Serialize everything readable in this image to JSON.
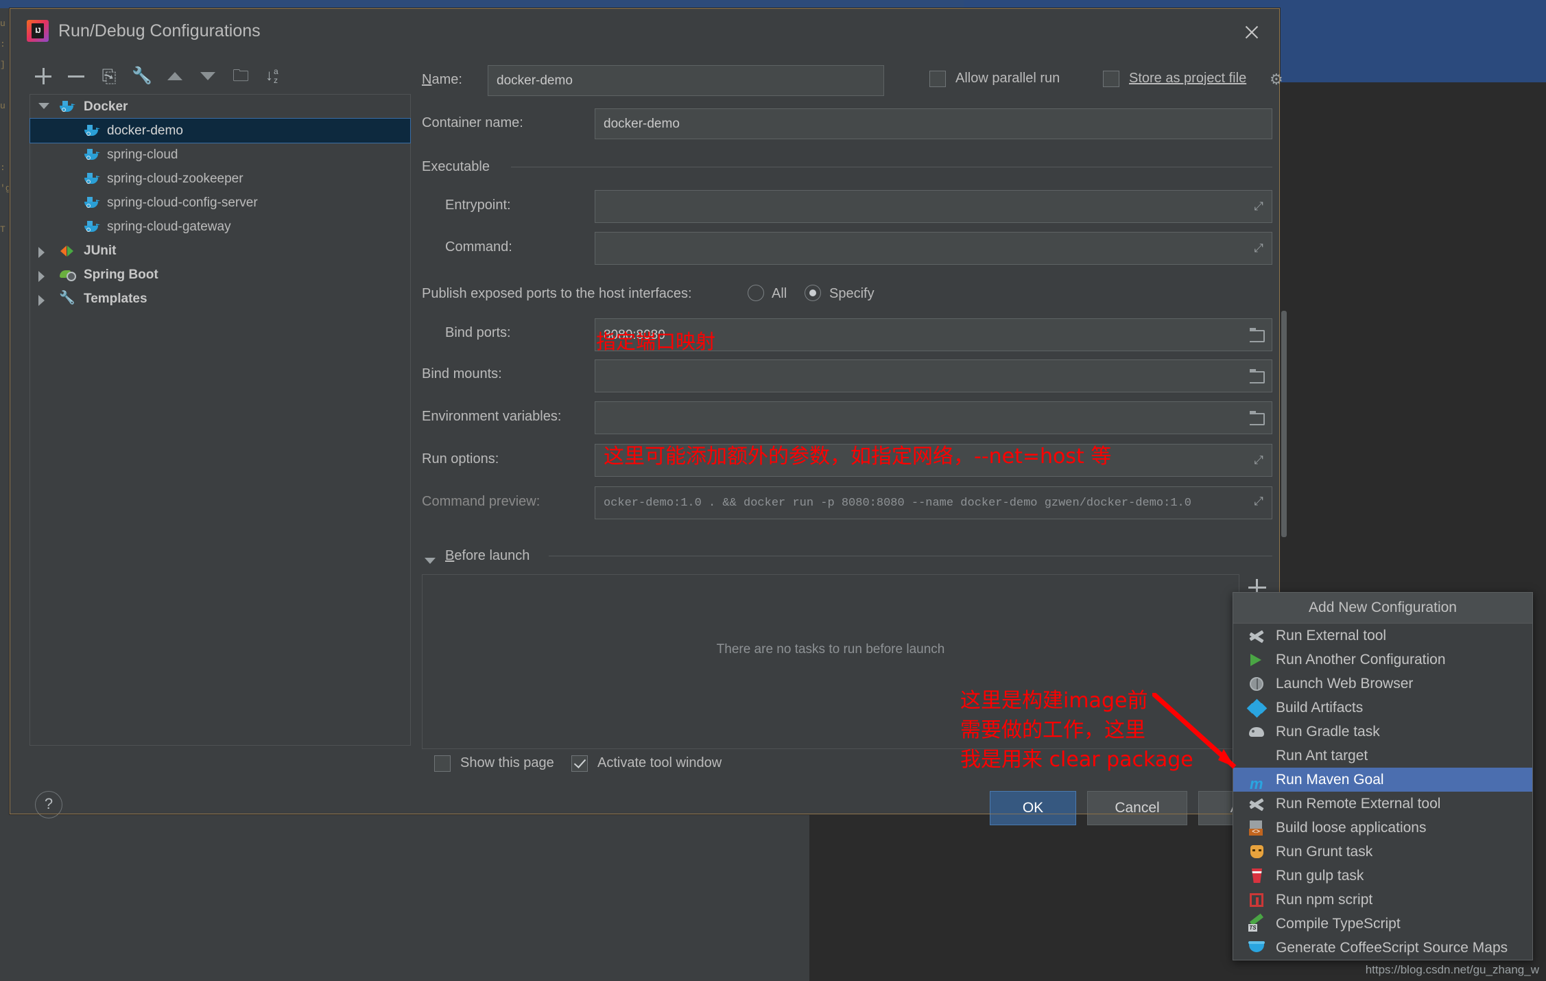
{
  "window": {
    "title": "Run/Debug Configurations",
    "app_icon": "intellij-idea-icon",
    "close_icon": "close-icon"
  },
  "toolbar": {
    "buttons": [
      {
        "name": "add-configuration-button",
        "icon": "plus-icon"
      },
      {
        "name": "remove-configuration-button",
        "icon": "minus-icon"
      },
      {
        "name": "copy-configuration-button",
        "icon": "copy-icon"
      },
      {
        "name": "edit-templates-button",
        "icon": "wrench-icon"
      },
      {
        "name": "move-up-button",
        "icon": "arrow-up-icon"
      },
      {
        "name": "move-down-button",
        "icon": "arrow-down-icon"
      },
      {
        "name": "new-folder-button",
        "icon": "folder-add-icon"
      },
      {
        "name": "sort-configurations-button",
        "icon": "sort-az-icon"
      }
    ],
    "sort_glyphs": {
      "arrow": "↓",
      "a": "a",
      "z": "z"
    },
    "copy_glyph": "⎘",
    "wrench_glyph": "🔧",
    "folder_glyph": "🗀"
  },
  "tree": {
    "groups": [
      {
        "label": "Docker",
        "icon": "docker-icon",
        "expanded": true,
        "children": [
          {
            "label": "docker-demo",
            "icon": "docker-icon",
            "selected": true
          },
          {
            "label": "spring-cloud",
            "icon": "docker-icon",
            "selected": false
          },
          {
            "label": "spring-cloud-zookeeper",
            "icon": "docker-icon",
            "selected": false
          },
          {
            "label": "spring-cloud-config-server",
            "icon": "docker-icon",
            "selected": false
          },
          {
            "label": "spring-cloud-gateway",
            "icon": "docker-icon",
            "selected": false
          }
        ]
      },
      {
        "label": "JUnit",
        "icon": "junit-icon",
        "expanded": false,
        "children": []
      },
      {
        "label": "Spring Boot",
        "icon": "spring-boot-icon",
        "expanded": false,
        "children": []
      },
      {
        "label": "Templates",
        "icon": "wrench-icon",
        "expanded": false,
        "children": []
      }
    ]
  },
  "form": {
    "name_label": "Name:",
    "name_value": "docker-demo",
    "allow_parallel_run_label": "Allow parallel run",
    "allow_parallel_run_checked": false,
    "store_as_project_file_label": "Store as project file",
    "store_as_project_file_checked": false,
    "gear_icon": "gear-icon",
    "container_name_label": "Container name:",
    "container_name_value": "docker-demo",
    "executable_section": "Executable",
    "entrypoint_label": "Entrypoint:",
    "entrypoint_value": "",
    "command_label": "Command:",
    "command_value": "",
    "publish_ports_label": "Publish exposed ports to the host interfaces:",
    "publish_all_label": "All",
    "publish_specify_label": "Specify",
    "publish_selected": "Specify",
    "bind_ports_label": "Bind ports:",
    "bind_ports_value": "8080:8080",
    "bind_mounts_label": "Bind mounts:",
    "bind_mounts_value": "",
    "env_vars_label": "Environment variables:",
    "env_vars_value": "",
    "run_options_label": "Run options:",
    "run_options_value": "",
    "command_preview_label": "Command preview:",
    "command_preview_value": "ocker-demo:1.0 . && docker run -p 8080:8080 --name docker-demo gzwen/docker-demo:1.0",
    "expand_glyph": "⤢"
  },
  "before_launch": {
    "section_label": "Before launch",
    "empty_text": "There are no tasks to run before launch",
    "add_task_icon": "plus-icon"
  },
  "bottom": {
    "show_this_page_label": "Show this page",
    "show_this_page_checked": false,
    "activate_tool_window_label": "Activate tool window",
    "activate_tool_window_checked": true,
    "ok_label": "OK",
    "cancel_label": "Cancel",
    "apply_label": "Apply",
    "help_label": "?"
  },
  "popup": {
    "title": "Add New Configuration",
    "items": [
      {
        "label": "Run External tool",
        "icon": "tools-icon",
        "selected": false
      },
      {
        "label": "Run Another Configuration",
        "icon": "play-icon",
        "selected": false
      },
      {
        "label": "Launch Web Browser",
        "icon": "globe-icon",
        "selected": false
      },
      {
        "label": "Build Artifacts",
        "icon": "artifacts-icon",
        "selected": false
      },
      {
        "label": "Run Gradle task",
        "icon": "gradle-elephant-icon",
        "selected": false
      },
      {
        "label": "Run Ant target",
        "icon": "ant-icon",
        "selected": false
      },
      {
        "label": "Run Maven Goal",
        "icon": "maven-icon",
        "selected": true
      },
      {
        "label": "Run Remote External tool",
        "icon": "tools-icon",
        "selected": false
      },
      {
        "label": "Build loose applications",
        "icon": "loose-app-icon",
        "selected": false
      },
      {
        "label": "Run Grunt task",
        "icon": "grunt-icon",
        "selected": false
      },
      {
        "label": "Run gulp task",
        "icon": "gulp-icon",
        "selected": false
      },
      {
        "label": "Run npm script",
        "icon": "npm-icon",
        "selected": false
      },
      {
        "label": "Compile TypeScript",
        "icon": "typescript-icon",
        "selected": false
      },
      {
        "label": "Generate CoffeeScript Source Maps",
        "icon": "coffeescript-icon",
        "selected": false
      }
    ],
    "maven_glyph": "m",
    "loose_glyph": "<>",
    "ts_glyph": "TS"
  },
  "annotations": {
    "ports_note": "指定端口映射",
    "run_options_note": "这里可能添加额外的参数，如指定网络，--net=host 等",
    "before_launch_note": "这里是构建image前\n需要做的工作，这里\n我是用来 clear package"
  },
  "watermark": "https://blog.csdn.net/gu_zhang_w",
  "background_editor_text": "u\n:\n]\n\nu\n\n\n:\n'g\n\nT",
  "colors": {
    "dialog_bg": "#3c3f41",
    "field_bg": "#45494a",
    "selection_blue": "#4b6eaf",
    "primary_button": "#365880",
    "annotation_red": "#ff0000",
    "docker_blue": "#2a9fd6"
  }
}
